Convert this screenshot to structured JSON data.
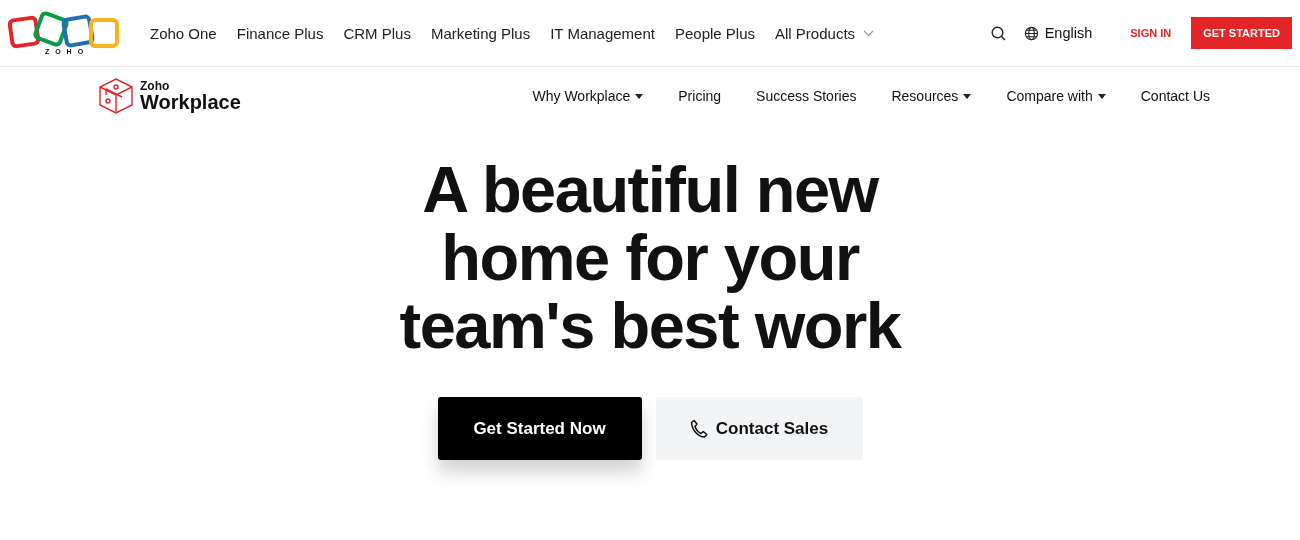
{
  "top_bar": {
    "logo_text": "ZOHO",
    "links": [
      {
        "label": "Zoho One",
        "dropdown": false
      },
      {
        "label": "Finance Plus",
        "dropdown": false
      },
      {
        "label": "CRM Plus",
        "dropdown": false
      },
      {
        "label": "Marketing Plus",
        "dropdown": false
      },
      {
        "label": "IT Management",
        "dropdown": false
      },
      {
        "label": "People Plus",
        "dropdown": false
      },
      {
        "label": "All Products",
        "dropdown": true
      }
    ],
    "language": "English",
    "sign_in": "SIGN IN",
    "get_started": "GET STARTED"
  },
  "product_nav": {
    "brand_small": "Zoho",
    "brand_large": "Workplace",
    "links": [
      {
        "label": "Why Workplace",
        "dropdown": true
      },
      {
        "label": "Pricing",
        "dropdown": false
      },
      {
        "label": "Success Stories",
        "dropdown": false
      },
      {
        "label": "Resources",
        "dropdown": true
      },
      {
        "label": "Compare with",
        "dropdown": true
      },
      {
        "label": "Contact Us",
        "dropdown": false
      }
    ]
  },
  "hero": {
    "headline_lines": [
      "A beautiful new",
      "home for your",
      "team's best work"
    ],
    "primary_button": "Get Started Now",
    "secondary_button": "Contact Sales"
  }
}
